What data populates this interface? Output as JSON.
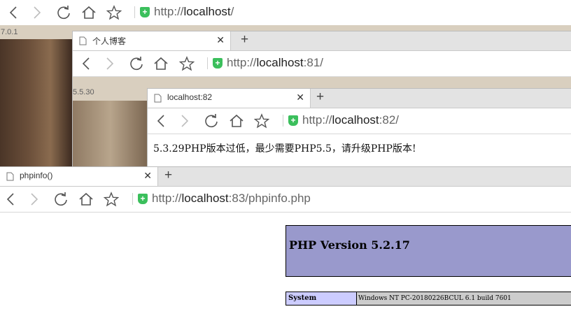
{
  "win1": {
    "url_scheme": "http://",
    "url_host": "localhost",
    "url_rest": "/",
    "bg_label": "7.0.1"
  },
  "win2": {
    "tab_title": "个人博客",
    "url_scheme": "http://",
    "url_host": "localhost",
    "url_rest": ":81/",
    "bg_label": "5.5.30"
  },
  "win3": {
    "tab_title": "localhost:82",
    "url_scheme": "http://",
    "url_host": "localhost",
    "url_rest": ":82/",
    "message": "5.3.29PHP版本过低，最少需要PHP5.5，请升级PHP版本!"
  },
  "win4": {
    "tab_title": "phpinfo()",
    "url_scheme": "http://",
    "url_host": "localhost",
    "url_rest": ":83/phpinfo.php",
    "php_version": "PHP Version 5.2.17",
    "table_rows": [
      {
        "key": "System",
        "value": "Windows NT PC-20180226BCUL 6.1 build 7601"
      }
    ]
  },
  "icons": {
    "back": "chevron-left-icon",
    "forward": "chevron-right-icon",
    "reload": "reload-icon",
    "home": "home-icon",
    "star": "star-icon",
    "shield": "secure-shield-icon",
    "page": "page-icon",
    "close": "close-icon",
    "new_tab": "plus-icon"
  },
  "colors": {
    "shield_green": "#3bbf5c",
    "php_header": "#9999cc",
    "php_key": "#ccccff",
    "php_value": "#cccccc"
  }
}
